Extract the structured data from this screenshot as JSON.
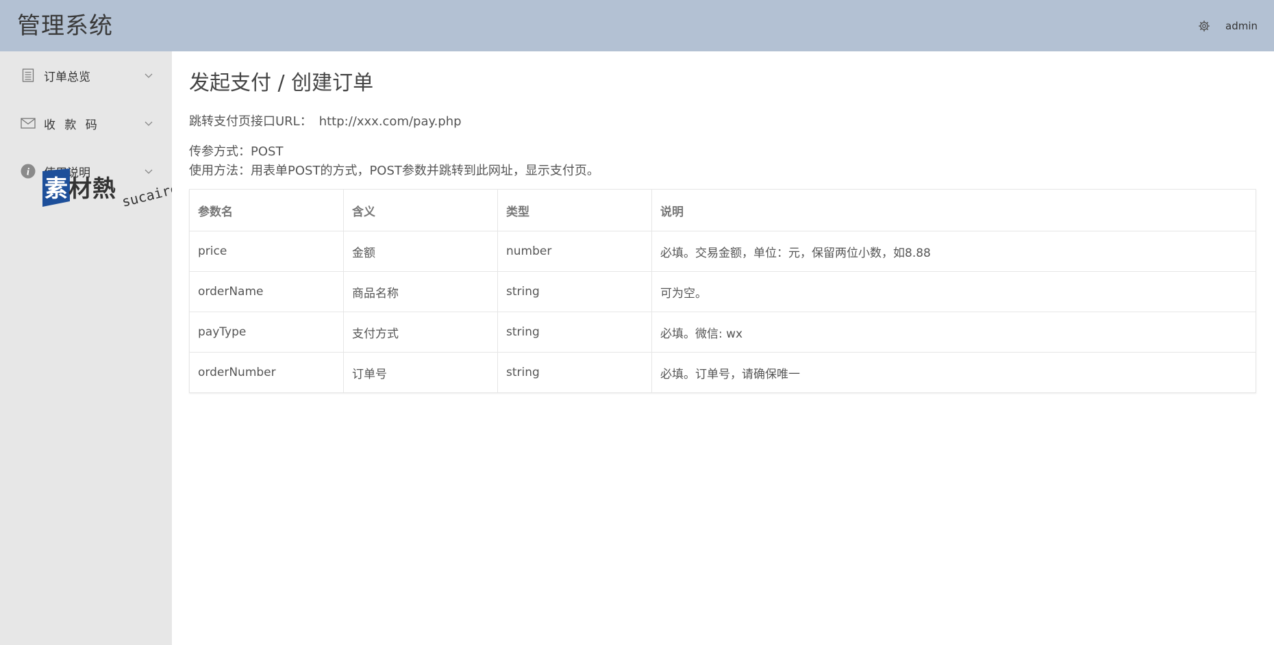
{
  "header": {
    "app_title": "管理系统",
    "settings_icon": "gear-icon",
    "username": "admin"
  },
  "sidebar": {
    "items": [
      {
        "label": "订单总览",
        "icon": "document-list-icon"
      },
      {
        "label": "收 款 码",
        "icon": "envelope-icon"
      },
      {
        "label": "使用说明",
        "icon": "info-circle-icon"
      }
    ]
  },
  "watermark": {
    "text_cn": "素材熱",
    "text_url": "sucaire.com"
  },
  "main": {
    "title": "发起支付 / 创建订单",
    "url_label": "跳转支付页接口URL：",
    "url_value": "http://xxx.com/pay.php",
    "method_line": "传参方式：POST",
    "usage_line": "使用方法：用表单POST的方式，POST参数并跳转到此网址，显示支付页。"
  },
  "table": {
    "headers": [
      "参数名",
      "含义",
      "类型",
      "说明"
    ],
    "rows": [
      [
        "price",
        "金额",
        "number",
        "必填。交易金额，单位：元，保留两位小数，如8.88"
      ],
      [
        "orderName",
        "商品名称",
        "string",
        "可为空。"
      ],
      [
        "payType",
        "支付方式",
        "string",
        "必填。微信: wx"
      ],
      [
        "orderNumber",
        "订单号",
        "string",
        "必填。订单号，请确保唯一"
      ]
    ]
  },
  "colors": {
    "header_bg": "#b3c1d3",
    "sidebar_bg": "#e7e7e7",
    "watermark_blue": "#1d4f9a"
  }
}
